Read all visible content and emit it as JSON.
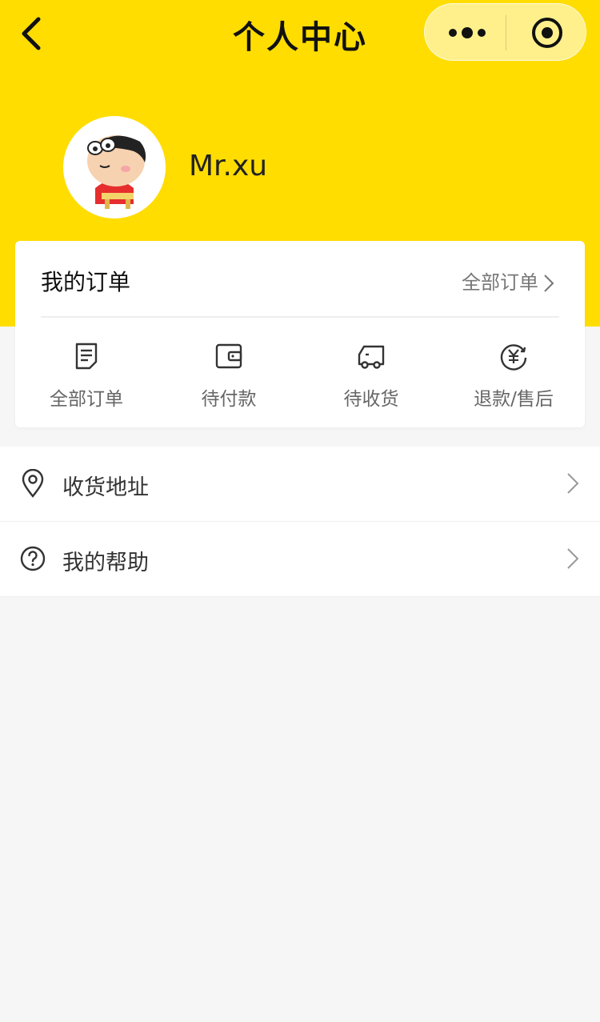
{
  "nav": {
    "title": "个人中心",
    "back_icon": "chevron-left-icon",
    "more_icon": "more-dots-icon",
    "close_icon": "target-close-icon"
  },
  "theme": {
    "primary": "#ffdd00",
    "background": "#f6f6f6",
    "card": "#ffffff"
  },
  "profile": {
    "username": "Mr.xu",
    "avatar_icon": "cartoon-avatar"
  },
  "orders": {
    "title": "我的订单",
    "all_link": "全部订单",
    "items": [
      {
        "label": "全部订单",
        "icon": "document-icon"
      },
      {
        "label": "待付款",
        "icon": "wallet-icon"
      },
      {
        "label": "待收货",
        "icon": "truck-icon"
      },
      {
        "label": "退款/售后",
        "icon": "refund-yen-icon"
      }
    ]
  },
  "menu": {
    "items": [
      {
        "label": "收货地址",
        "icon": "location-pin-icon"
      },
      {
        "label": "我的帮助",
        "icon": "help-circle-icon"
      }
    ]
  }
}
